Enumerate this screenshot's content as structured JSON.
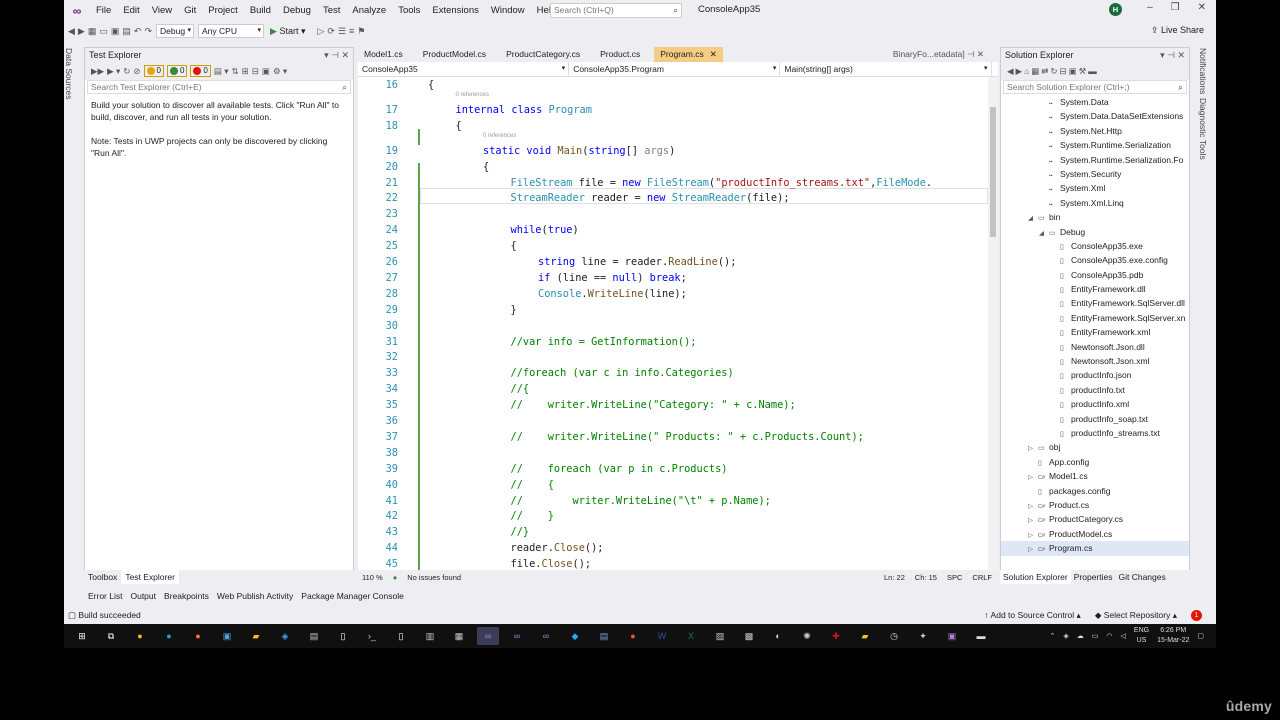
{
  "titlebar": {
    "menu": [
      "File",
      "Edit",
      "View",
      "Git",
      "Project",
      "Build",
      "Debug",
      "Test",
      "Analyze",
      "Tools",
      "Extensions",
      "Window",
      "Help"
    ],
    "search_placeholder": "Search (Ctrl+Q)",
    "app_title": "ConsoleApp35",
    "avatar": "H",
    "live_share": "Live Share"
  },
  "toolbar": {
    "config": "Debug",
    "platform": "Any CPU",
    "start": "Start"
  },
  "side_tabs": {
    "left": [
      "Data Sources"
    ],
    "right": [
      "Notifications",
      "Diagnostic Tools"
    ]
  },
  "test_explorer": {
    "title": "Test Explorer",
    "counts": {
      "warn": "0",
      "pass": "0",
      "fail": "0"
    },
    "search_placeholder": "Search Test Explorer (Ctrl+E)",
    "message1": "Build your solution to discover all available tests. Click \"Run All\" to build, discover, and run all tests in your solution.",
    "message2": "Note: Tests in UWP projects can only be discovered by clicking \"Run All\".",
    "tabs": [
      "Toolbox",
      "Test Explorer"
    ]
  },
  "editor": {
    "doc_tabs": [
      "Model1.cs",
      "ProductModel.cs",
      "ProductCategory.cs",
      "Product.cs",
      "Program.cs"
    ],
    "preview_tab": "BinaryFo...etadata]",
    "nav": [
      "ConsoleApp35",
      "ConsoleApp35.Program",
      "Main(string[] args)"
    ],
    "refs": "0 references",
    "status": {
      "zoom": "110 %",
      "issues": "No issues found",
      "ln": "Ln: 22",
      "ch": "Ch: 15",
      "spc": "SPC",
      "crlf": "CRLF"
    }
  },
  "code_lines": [
    {
      "n": "16",
      "t": "{"
    },
    {
      "n": "17",
      "t": "internal class Program"
    },
    {
      "n": "18",
      "t": "{"
    },
    {
      "n": "19",
      "t": "static void Main(string[] args)"
    },
    {
      "n": "20",
      "t": "{"
    },
    {
      "n": "21",
      "t": "FileStream file = new FileStream(\"productInfo_streams.txt\",FileMode."
    },
    {
      "n": "22",
      "t": "StreamReader reader = new StreamReader(file);"
    },
    {
      "n": "23",
      "t": ""
    },
    {
      "n": "24",
      "t": "while(true)"
    },
    {
      "n": "25",
      "t": "{"
    },
    {
      "n": "26",
      "t": "string line = reader.ReadLine();"
    },
    {
      "n": "27",
      "t": "if (line == null) break;"
    },
    {
      "n": "28",
      "t": "Console.WriteLine(line);"
    },
    {
      "n": "29",
      "t": "}"
    },
    {
      "n": "30",
      "t": ""
    },
    {
      "n": "31",
      "t": "//var info = GetInformation();"
    },
    {
      "n": "32",
      "t": ""
    },
    {
      "n": "33",
      "t": "//foreach (var c in info.Categories)"
    },
    {
      "n": "34",
      "t": "//{"
    },
    {
      "n": "35",
      "t": "//    writer.WriteLine(\"Category: \" + c.Name);"
    },
    {
      "n": "36",
      "t": ""
    },
    {
      "n": "37",
      "t": "//    writer.WriteLine(\" Products: \" + c.Products.Count);"
    },
    {
      "n": "38",
      "t": ""
    },
    {
      "n": "39",
      "t": "//    foreach (var p in c.Products)"
    },
    {
      "n": "40",
      "t": "//    {"
    },
    {
      "n": "41",
      "t": "//        writer.WriteLine(\"\\t\" + p.Name);"
    },
    {
      "n": "42",
      "t": "//    }"
    },
    {
      "n": "43",
      "t": "//}"
    },
    {
      "n": "44",
      "t": "reader.Close();"
    },
    {
      "n": "45",
      "t": "file.Close();"
    }
  ],
  "solution_explorer": {
    "title": "Solution Explorer",
    "search_placeholder": "Search Solution Explorer (Ctrl+;)",
    "items": [
      "System.Data",
      "System.Data.DataSetExtensions",
      "System.Net.Http",
      "System.Runtime.Serialization",
      "System.Runtime.Serialization.Fo",
      "System.Security",
      "System.Xml",
      "System.Xml.Linq",
      "bin",
      "Debug",
      "ConsoleApp35.exe",
      "ConsoleApp35.exe.config",
      "ConsoleApp35.pdb",
      "EntityFramework.dll",
      "EntityFramework.SqlServer.dll",
      "EntityFramework.SqlServer.xn",
      "EntityFramework.xml",
      "Newtonsoft.Json.dll",
      "Newtonsoft.Json.xml",
      "productInfo.json",
      "productInfo.txt",
      "productInfo.xml",
      "productInfo_soap.txt",
      "productInfo_streams.txt",
      "obj",
      "App.config",
      "Model1.cs",
      "packages.config",
      "Product.cs",
      "ProductCategory.cs",
      "ProductModel.cs",
      "Program.cs"
    ],
    "tabs": [
      "Solution Explorer",
      "Properties",
      "Git Changes"
    ]
  },
  "bottom_tabs": [
    "Error List",
    "Output",
    "Breakpoints",
    "Web Publish Activity",
    "Package Manager Console"
  ],
  "statusbar": {
    "left": "Build succeeded",
    "source_control": "Add to Source Control",
    "repo": "Select Repository",
    "notifications": "1"
  },
  "taskbar": {
    "lang": "ENG",
    "region": "US",
    "time": "6:26 PM",
    "date": "15-Mar-22"
  },
  "watermark": "ûdemy"
}
